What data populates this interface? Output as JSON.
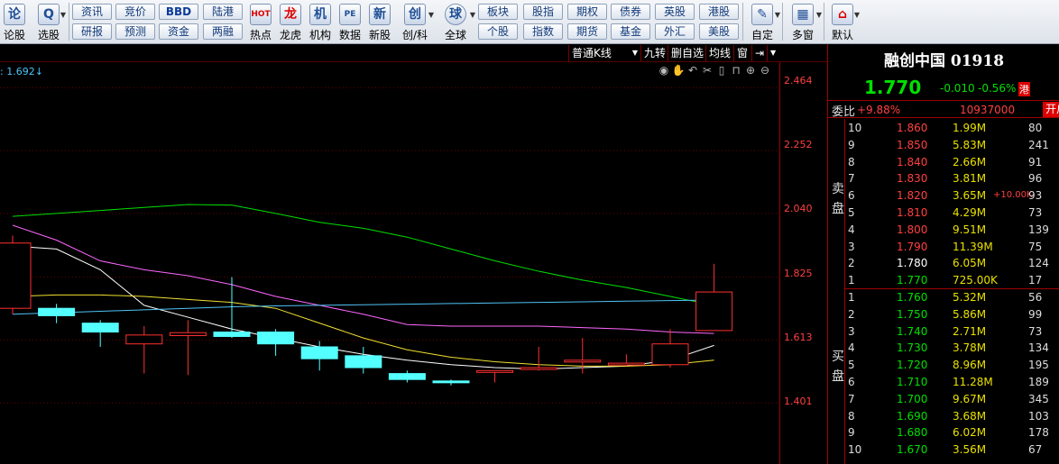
{
  "toolbar": {
    "big_buttons": [
      {
        "label": "论股",
        "icon": "论"
      },
      {
        "label": "选股",
        "icon": "Q"
      },
      {
        "label": "热点",
        "icon": "HOT"
      },
      {
        "label": "龙虎",
        "icon": "龙"
      },
      {
        "label": "机构",
        "icon": "机"
      },
      {
        "label": "数据",
        "icon": "PE"
      },
      {
        "label": "新股",
        "icon": "新"
      },
      {
        "label": "创/科",
        "icon": "创"
      },
      {
        "label": "全球",
        "icon": "球"
      },
      {
        "label": "自定",
        "icon": "✎"
      },
      {
        "label": "多窗",
        "icon": "▦"
      },
      {
        "label": "默认",
        "icon": "⌂"
      }
    ],
    "row1": [
      "资讯",
      "竞价",
      "BBD",
      "陆港",
      "板块",
      "股指",
      "期权",
      "债券",
      "英股",
      "港股"
    ],
    "row2": [
      "研报",
      "预测",
      "资金",
      "两融",
      "个股",
      "指数",
      "期货",
      "基金",
      "外汇",
      "美股"
    ]
  },
  "chart": {
    "tabs": [
      "普通K线",
      "九转",
      "删自选",
      "均线",
      "窗"
    ],
    "ma_label": ": 1.692↓",
    "price_labels": [
      "2.464",
      "2.252",
      "2.040",
      "1.825",
      "1.613",
      "1.401"
    ],
    "ylim": [
      1.195,
      2.55
    ],
    "candles": [
      {
        "o": 1.72,
        "c": 1.94,
        "h": 1.965,
        "l": 1.7
      },
      {
        "o": 1.72,
        "c": 1.695,
        "h": 1.735,
        "l": 1.67
      },
      {
        "o": 1.67,
        "c": 1.64,
        "h": 1.68,
        "l": 1.59
      },
      {
        "o": 1.6,
        "c": 1.63,
        "h": 1.66,
        "l": 1.5
      },
      {
        "o": 1.628,
        "c": 1.638,
        "h": 1.68,
        "l": 1.495
      },
      {
        "o": 1.64,
        "c": 1.625,
        "h": 1.825,
        "l": 1.62
      },
      {
        "o": 1.64,
        "c": 1.6,
        "h": 1.65,
        "l": 1.56
      },
      {
        "o": 1.59,
        "c": 1.55,
        "h": 1.61,
        "l": 1.51
      },
      {
        "o": 1.56,
        "c": 1.52,
        "h": 1.59,
        "l": 1.5
      },
      {
        "o": 1.5,
        "c": 1.48,
        "h": 1.51,
        "l": 1.47
      },
      {
        "o": 1.475,
        "c": 1.47,
        "h": 1.48,
        "l": 1.46
      },
      {
        "o": 1.505,
        "c": 1.51,
        "h": 1.51,
        "l": 1.47
      },
      {
        "o": 1.515,
        "c": 1.52,
        "h": 1.59,
        "l": 1.51
      },
      {
        "o": 1.54,
        "c": 1.545,
        "h": 1.62,
        "l": 1.5
      },
      {
        "o": 1.532,
        "c": 1.535,
        "h": 1.565,
        "l": 1.525
      },
      {
        "o": 1.53,
        "c": 1.6,
        "h": 1.65,
        "l": 1.52
      },
      {
        "o": 1.645,
        "c": 1.775,
        "h": 1.87,
        "l": 1.645
      }
    ],
    "ma_lines": [
      {
        "color": "#ffffff",
        "values": [
          1.93,
          1.92,
          1.85,
          1.73,
          1.69,
          1.65,
          1.62,
          1.59,
          1.565,
          1.545,
          1.53,
          1.52,
          1.515,
          1.52,
          1.525,
          1.545,
          1.595
        ]
      },
      {
        "color": "#f0e030",
        "values": [
          1.76,
          1.765,
          1.765,
          1.76,
          1.75,
          1.74,
          1.72,
          1.67,
          1.62,
          1.58,
          1.555,
          1.54,
          1.53,
          1.525,
          1.525,
          1.53,
          1.545
        ]
      },
      {
        "color": "#ff66ff",
        "values": [
          2.0,
          1.95,
          1.88,
          1.85,
          1.83,
          1.8,
          1.76,
          1.73,
          1.7,
          1.665,
          1.66,
          1.66,
          1.66,
          1.655,
          1.65,
          1.64,
          1.635
        ]
      },
      {
        "color": "#00e000",
        "values": [
          2.03,
          2.04,
          2.05,
          2.06,
          2.07,
          2.068,
          2.04,
          2.01,
          1.99,
          1.96,
          1.92,
          1.88,
          1.845,
          1.815,
          1.79,
          1.76,
          1.73
        ]
      },
      {
        "color": "#4fc3f7",
        "values": [
          1.7,
          1.705,
          1.71,
          1.715,
          1.72,
          1.725,
          1.728,
          1.73,
          1.732,
          1.734,
          1.736,
          1.738,
          1.74,
          1.742,
          1.744,
          1.746,
          1.748
        ]
      }
    ]
  },
  "book": {
    "name": "融创中国 01918",
    "price": "1.770",
    "change": "-0.010",
    "change_pct": "-0.56%",
    "market_badge": "港",
    "ratio_label": "委比",
    "ratio": "+9.88%",
    "ratio_vol": "10937000",
    "open_label": "开户",
    "sell_label": "卖盘",
    "buy_label": "买盘",
    "sell": [
      {
        "lvl": "10",
        "price": "1.860",
        "vol": "1.99M",
        "cnt": "80",
        "note": ""
      },
      {
        "lvl": "9",
        "price": "1.850",
        "vol": "5.83M",
        "cnt": "241",
        "note": ""
      },
      {
        "lvl": "8",
        "price": "1.840",
        "vol": "2.66M",
        "cnt": "91",
        "note": ""
      },
      {
        "lvl": "7",
        "price": "1.830",
        "vol": "3.81M",
        "cnt": "96",
        "note": ""
      },
      {
        "lvl": "6",
        "price": "1.820",
        "vol": "3.65M",
        "cnt": "93",
        "note": "+10.00K"
      },
      {
        "lvl": "5",
        "price": "1.810",
        "vol": "4.29M",
        "cnt": "73",
        "note": ""
      },
      {
        "lvl": "4",
        "price": "1.800",
        "vol": "9.51M",
        "cnt": "139",
        "note": ""
      },
      {
        "lvl": "3",
        "price": "1.790",
        "vol": "11.39M",
        "cnt": "75",
        "note": ""
      },
      {
        "lvl": "2",
        "price": "1.780",
        "vol": "6.05M",
        "cnt": "124",
        "note": ""
      },
      {
        "lvl": "1",
        "price": "1.770",
        "vol": "725.00K",
        "cnt": "17",
        "note": ""
      }
    ],
    "buy": [
      {
        "lvl": "1",
        "price": "1.760",
        "vol": "5.32M",
        "cnt": "56"
      },
      {
        "lvl": "2",
        "price": "1.750",
        "vol": "5.86M",
        "cnt": "99"
      },
      {
        "lvl": "3",
        "price": "1.740",
        "vol": "2.71M",
        "cnt": "73"
      },
      {
        "lvl": "4",
        "price": "1.730",
        "vol": "3.78M",
        "cnt": "134"
      },
      {
        "lvl": "5",
        "price": "1.720",
        "vol": "8.96M",
        "cnt": "195"
      },
      {
        "lvl": "6",
        "price": "1.710",
        "vol": "11.28M",
        "cnt": "189"
      },
      {
        "lvl": "7",
        "price": "1.700",
        "vol": "9.67M",
        "cnt": "345"
      },
      {
        "lvl": "8",
        "price": "1.690",
        "vol": "3.68M",
        "cnt": "103"
      },
      {
        "lvl": "9",
        "price": "1.680",
        "vol": "6.02M",
        "cnt": "178"
      },
      {
        "lvl": "10",
        "price": "1.670",
        "vol": "3.56M",
        "cnt": "67"
      }
    ]
  }
}
